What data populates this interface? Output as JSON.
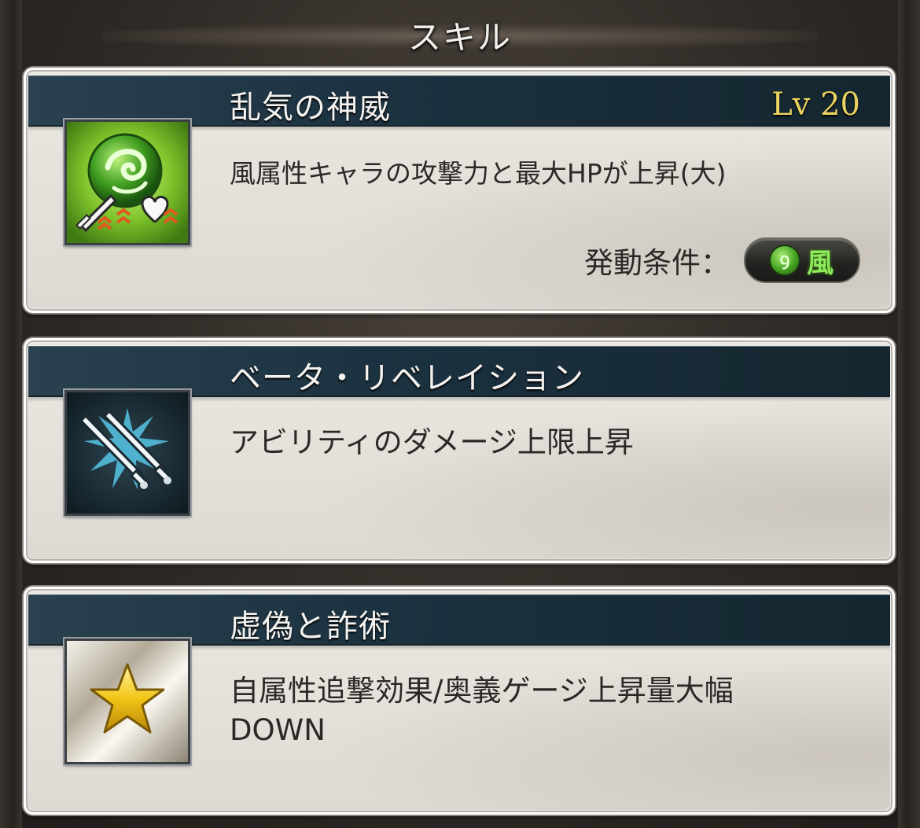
{
  "header": {
    "title": "スキル"
  },
  "skills": [
    {
      "name": "乱気の神威",
      "level": "Lv 20",
      "description": "風属性キャラの攻撃力と最大HPが上昇(大)",
      "activation_label": "発動条件：",
      "activation_element": "風",
      "icon": "wind-attack-hp-up-icon"
    },
    {
      "name": "ベータ・リベレイション",
      "description": "アビリティのダメージ上限上昇",
      "icon": "twin-swords-icon"
    },
    {
      "name": "虚偽と詐術",
      "description_line1": "自属性追撃効果/奥義ゲージ上昇量大幅",
      "description_line2": "DOWN",
      "icon": "gold-star-icon"
    }
  ],
  "colors": {
    "title_band": "#1c3240",
    "level_text": "#ecd25e",
    "wind_green": "#46a322",
    "card_bg": "#e4e1da"
  }
}
